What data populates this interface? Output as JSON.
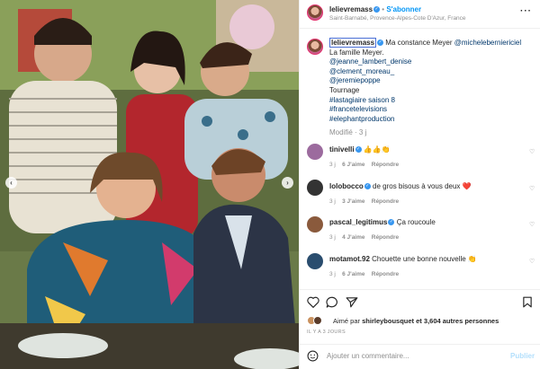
{
  "post": {
    "username": "lelievremass",
    "follow_label": "S'abonner",
    "location": "Saint-Barnabé, Provence-Alpes-Cote D'Azur, France",
    "more_icon": "more-horizontal-icon",
    "caption": {
      "username": "lelievremass",
      "line1_text": "Ma constance Meyer",
      "line1_mention": "@micheleberniericiel",
      "line2": "La famille Meyer.",
      "mentions": [
        "@jeanne_lambert_denise",
        "@clement_moreau_",
        "@jeremiepoppe"
      ],
      "line_tournage": "Tournage",
      "hashtags": [
        "#lastagiaire saison 8",
        "#francetelevisions",
        "#elephantproduction"
      ],
      "modified": "Modifié · 3 j"
    }
  },
  "comments": [
    {
      "username": "tinivelli",
      "text": "👍👍👏",
      "age": "3 j",
      "likes": "6 J'aime",
      "reply": "Répondre",
      "avatar_color": "#9c6b9e"
    },
    {
      "username": "lolobocco",
      "text": "de gros bisous à vous deux ❤️",
      "age": "3 j",
      "likes": "3 J'aime",
      "reply": "Répondre",
      "avatar_color": "#333333"
    },
    {
      "username": "pascal_legitimus",
      "text": "Ça roucoule",
      "age": "3 j",
      "likes": "4 J'aime",
      "reply": "Répondre",
      "avatar_color": "#8a5a3c"
    },
    {
      "username": "motamot.92",
      "text": "Chouette une bonne nouvelle 👏",
      "age": "3 j",
      "likes": "6 J'aime",
      "reply": "Répondre",
      "avatar_color": "#2a4d6e"
    }
  ],
  "actions": {
    "like_icon": "heart-icon",
    "comment_icon": "comment-icon",
    "share_icon": "share-icon",
    "save_icon": "bookmark-icon",
    "liked_by_prefix": "Aimé par",
    "liked_by_user": "shirleybousquet",
    "liked_by_suffix": "et 3,604 autres personnes",
    "timestamp": "IL Y A 3 JOURS"
  },
  "composer": {
    "emoji_icon": "smiley-icon",
    "placeholder": "Ajouter un commentaire...",
    "publish_label": "Publier"
  },
  "colors": {
    "accent_blue": "#0095f6",
    "verified_blue": "#3897f0",
    "text_primary": "#262626",
    "text_secondary": "#8e8e8e"
  }
}
